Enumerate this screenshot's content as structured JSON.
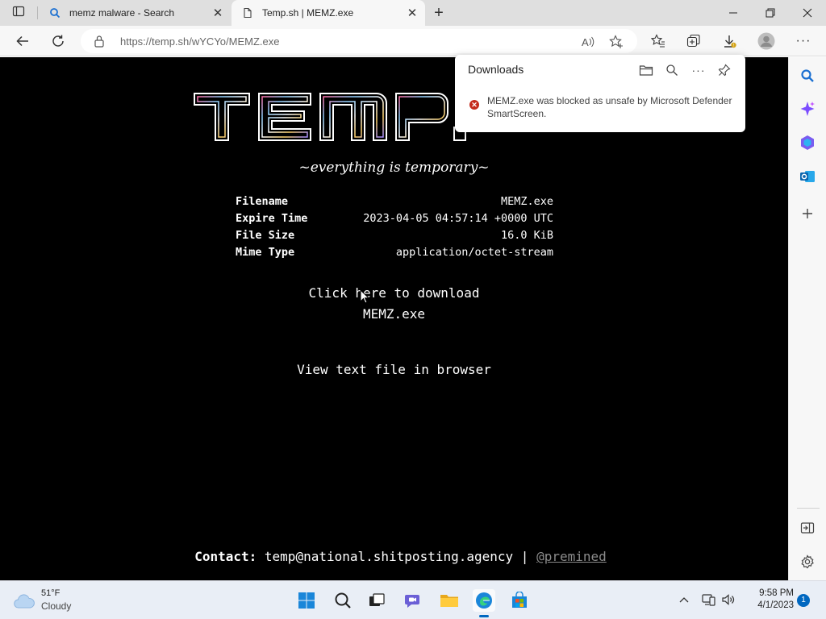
{
  "browser": {
    "tabs": [
      {
        "title": "memz malware - Search",
        "active": false,
        "icon": "search-icon"
      },
      {
        "title": "Temp.sh | MEMZ.exe",
        "active": true,
        "icon": "page-icon"
      }
    ],
    "url": "https://temp.sh/wYCYo/MEMZ.exe"
  },
  "page": {
    "logo_text": "TEMP.SH",
    "tagline": "~everything is temporary~",
    "file_info": [
      {
        "key": "Filename",
        "value": "MEMZ.exe"
      },
      {
        "key": "Expire Time",
        "value": "2023-04-05 04:57:14 +0000 UTC"
      },
      {
        "key": "File Size",
        "value": "16.0 KiB"
      },
      {
        "key": "Mime Type",
        "value": "application/octet-stream"
      }
    ],
    "download_line1": "Click here to download",
    "download_line2": "MEMZ.exe",
    "view_link": "View text file in browser",
    "contact_label": "Contact:",
    "contact_email": "temp@national.shitposting.agency",
    "contact_separator": "|",
    "contact_handle": "@premined"
  },
  "downloads": {
    "title": "Downloads",
    "item_message": "MEMZ.exe was blocked as unsafe by Microsoft Defender SmartScreen.",
    "status_color": "#c42b1c"
  },
  "taskbar": {
    "weather_temp": "51°F",
    "weather_condition": "Cloudy",
    "time": "9:58 PM",
    "date": "4/1/2023",
    "notification_count": "1"
  },
  "colors": {
    "page_bg": "#000000",
    "accent": "#0067c0"
  }
}
